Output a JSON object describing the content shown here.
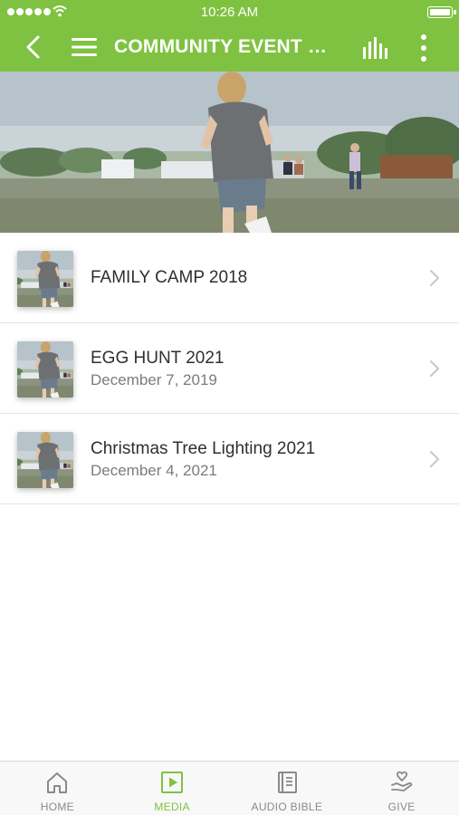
{
  "status_bar": {
    "time": "10:26 AM"
  },
  "nav": {
    "title": "COMMUNITY EVENT HI..."
  },
  "events": [
    {
      "title": "FAMILY CAMP 2018",
      "date": ""
    },
    {
      "title": "EGG HUNT 2021",
      "date": "December 7, 2019"
    },
    {
      "title": "Christmas Tree Lighting 2021",
      "date": "December 4, 2021"
    }
  ],
  "tabs": [
    {
      "label": "HOME",
      "icon": "home-icon",
      "active": false
    },
    {
      "label": "MEDIA",
      "icon": "media-play-icon",
      "active": true
    },
    {
      "label": "AUDIO BIBLE",
      "icon": "book-icon",
      "active": false
    },
    {
      "label": "GIVE",
      "icon": "hand-heart-icon",
      "active": false
    }
  ],
  "colors": {
    "accent": "#7fc241",
    "tab_inactive": "#8a8a8a",
    "text_primary": "#2f2f2f",
    "text_secondary": "#7b7b7b"
  }
}
